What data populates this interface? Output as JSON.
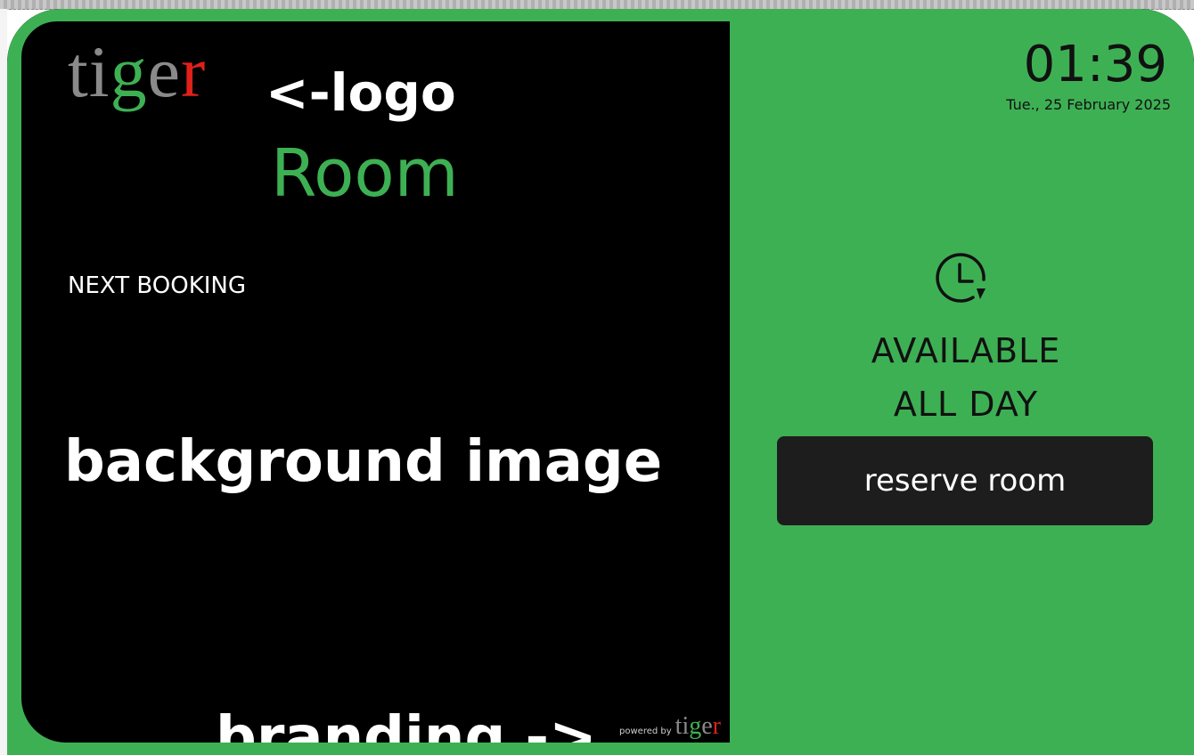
{
  "logo": {
    "letters": [
      {
        "char": "t",
        "color": "#8a8a8a"
      },
      {
        "char": "i",
        "color": "#8a8a8a",
        "dot_color": "#e8d21a"
      },
      {
        "char": "g",
        "color": "#3eb054"
      },
      {
        "char": "e",
        "color": "#8a8a8a"
      },
      {
        "char": "r",
        "color": "#e0201a"
      }
    ]
  },
  "annotations": {
    "logo": "<-logo",
    "background": "background image",
    "branding": "branding ->"
  },
  "room": {
    "name": "Room",
    "next_booking_label": "NEXT BOOKING"
  },
  "clock": {
    "time": "01:39",
    "date": "Tue., 25 February 2025"
  },
  "status": {
    "line1": "AVAILABLE",
    "line2": "ALL DAY",
    "icon": "clock-refresh-icon"
  },
  "actions": {
    "reserve_label": "reserve room"
  },
  "branding": {
    "powered_by": "powered by",
    "logo_text": "tiger"
  },
  "colors": {
    "available_green": "#3eb054",
    "panel_black": "#000000",
    "button_dark": "#1d1d1d"
  }
}
